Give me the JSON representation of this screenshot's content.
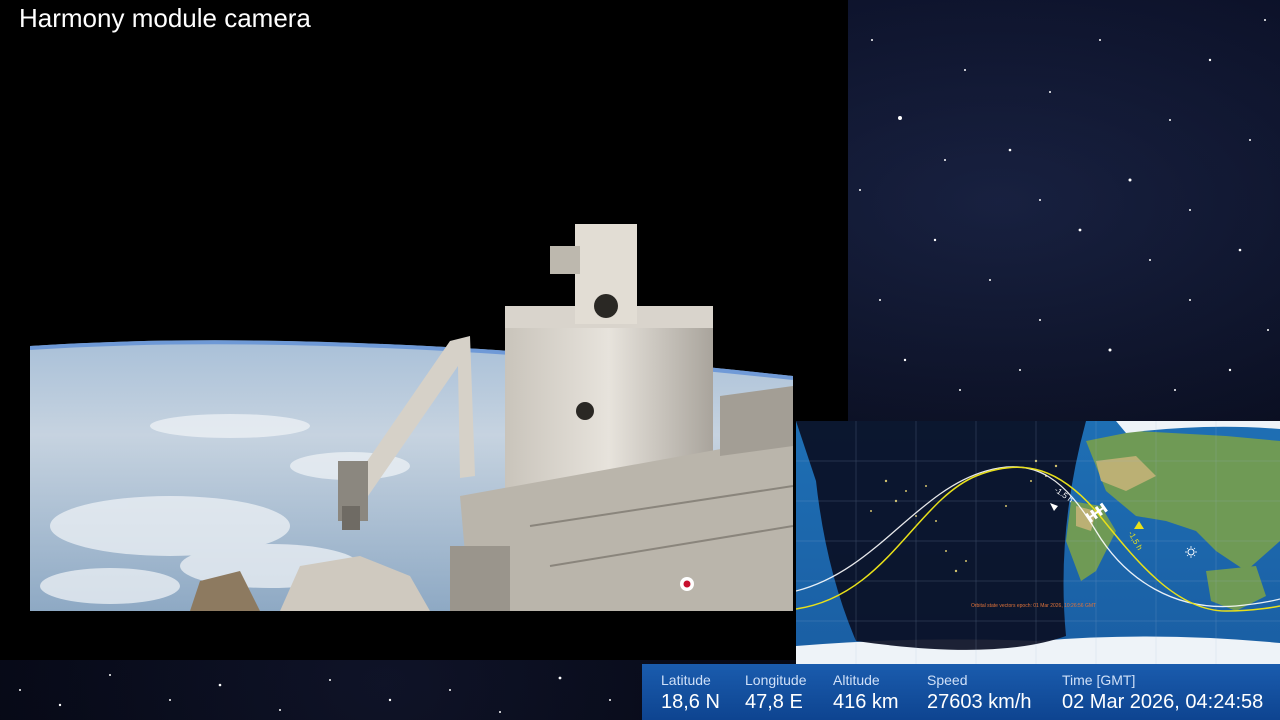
{
  "feed": {
    "title": "Harmony module camera"
  },
  "map": {
    "pass_marker_1": "-1.5 h",
    "pass_marker_2": "-1,5 h",
    "epoch_note": "Orbital state vectors epoch: 01 Mar 2026, 10:26:56 GMT"
  },
  "telemetry": {
    "latitude": {
      "label": "Latitude",
      "value": "18,6 N"
    },
    "longitude": {
      "label": "Longitude",
      "value": "47,8 E"
    },
    "altitude": {
      "label": "Altitude",
      "value": "416 km"
    },
    "speed": {
      "label": "Speed",
      "value": "27603 km/h"
    },
    "time": {
      "label": "Time [GMT]",
      "value": "02 Mar 2026, 04:24:58"
    }
  },
  "colors": {
    "telemetry_bar": "#1a5cae",
    "ground_track_current": "#e8e01a",
    "ground_track_next": "#ffffff",
    "night_shadow": "#0a0f24"
  }
}
